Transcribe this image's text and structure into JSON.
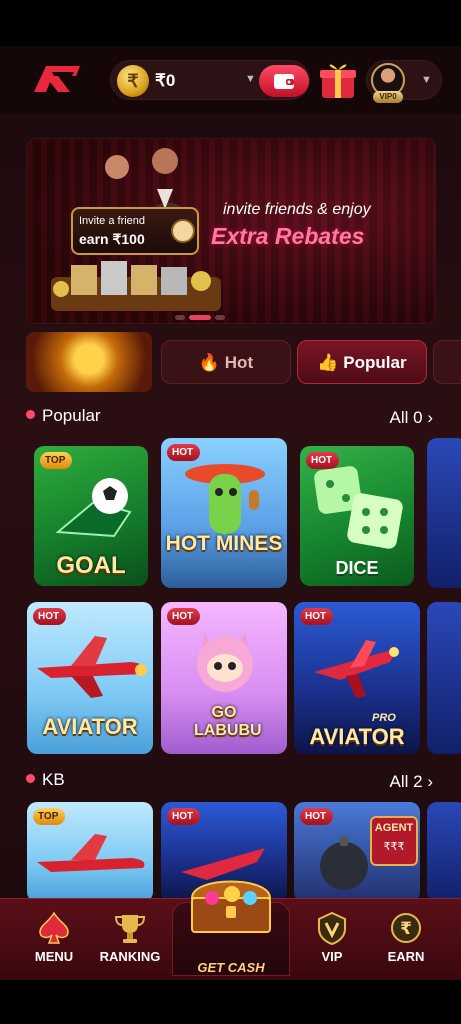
{
  "header": {
    "balance": "₹0",
    "vip_label": "VIP0"
  },
  "banner": {
    "invite_line1": "Invite a friend",
    "invite_line2": "earn ₹100",
    "headline": "invite friends & enjoy",
    "subheadline": "Extra Rebates",
    "slides": 3,
    "active_slide": 1
  },
  "tabs": {
    "hot": "Hot",
    "popular": "Popular"
  },
  "sections": {
    "popular": {
      "title": "Popular",
      "all": "All 0 ›"
    },
    "kb": {
      "title": "KB",
      "all": "All 2 ›"
    }
  },
  "games_row1": [
    {
      "name": "GOAL",
      "badge": "TOP"
    },
    {
      "name": "HOT MINES",
      "badge": "HOT"
    },
    {
      "name": "DICE",
      "badge": "HOT"
    }
  ],
  "games_row2": [
    {
      "name": "AVIATOR",
      "badge": "HOT"
    },
    {
      "name": "GO LABUBU",
      "badge": "HOT"
    },
    {
      "name": "AVIATOR",
      "badge": "HOT",
      "tag": "PRO"
    }
  ],
  "games_row3": [
    {
      "badge": "TOP"
    },
    {
      "badge": "HOT"
    },
    {
      "badge": "HOT",
      "title": "AGENT"
    }
  ],
  "nav": {
    "menu": "MENU",
    "ranking": "RANKING",
    "get_cash": "GET CASH",
    "vip": "VIP",
    "earn": "EARN"
  },
  "colors": {
    "accent": "#e8445e",
    "background": "#1a0a0c",
    "gold": "#ffd37a"
  }
}
